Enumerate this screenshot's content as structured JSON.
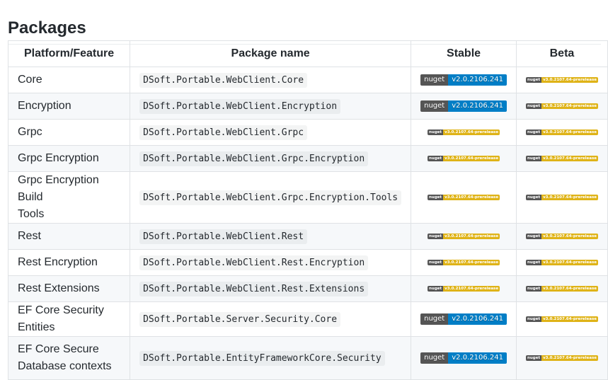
{
  "heading": "Packages",
  "columns": [
    "Platform/Feature",
    "Package name",
    "Stable",
    "Beta"
  ],
  "colors": {
    "badge_label": "#555555",
    "stable_release": "#007ec6",
    "prerelease": "#dfb317"
  },
  "rows": [
    {
      "feature": "Core",
      "package": "DSoft.Portable.WebClient.Core",
      "stable": {
        "label": "nuget",
        "version": "v2.0.2106.241",
        "kind": "release"
      },
      "beta": {
        "label": "nuget",
        "version": "v3.0.2107.64-prerelease",
        "kind": "prerelease"
      }
    },
    {
      "feature": "Encryption",
      "package": "DSoft.Portable.WebClient.Encryption",
      "stable": {
        "label": "nuget",
        "version": "v2.0.2106.241",
        "kind": "release"
      },
      "beta": {
        "label": "nuget",
        "version": "v3.0.2107.64-prerelease",
        "kind": "prerelease"
      }
    },
    {
      "feature": "Grpc",
      "package": "DSoft.Portable.WebClient.Grpc",
      "stable": {
        "label": "nuget",
        "version": "v3.0.2107.64-prerelease",
        "kind": "prerelease"
      },
      "beta": {
        "label": "nuget",
        "version": "v3.0.2107.64-prerelease",
        "kind": "prerelease"
      }
    },
    {
      "feature": "Grpc Encryption",
      "package": "DSoft.Portable.WebClient.Grpc.Encryption",
      "stable": {
        "label": "nuget",
        "version": "v3.0.2107.64-prerelease",
        "kind": "prerelease"
      },
      "beta": {
        "label": "nuget",
        "version": "v3.0.2107.64-prerelease",
        "kind": "prerelease"
      }
    },
    {
      "feature_line1": "Grpc Encryption Build",
      "feature_line2": "Tools",
      "package": "DSoft.Portable.WebClient.Grpc.Encryption.Tools",
      "stable": {
        "label": "nuget",
        "version": "v3.0.2107.64-prerelease",
        "kind": "prerelease"
      },
      "beta": {
        "label": "nuget",
        "version": "v3.0.2107.64-prerelease",
        "kind": "prerelease"
      }
    },
    {
      "feature": "Rest",
      "package": "DSoft.Portable.WebClient.Rest",
      "stable": {
        "label": "nuget",
        "version": "v3.0.2107.64-prerelease",
        "kind": "prerelease"
      },
      "beta": {
        "label": "nuget",
        "version": "v3.0.2107.64-prerelease",
        "kind": "prerelease"
      }
    },
    {
      "feature": "Rest Encryption",
      "package": "DSoft.Portable.WebClient.Rest.Encryption",
      "stable": {
        "label": "nuget",
        "version": "v3.0.2107.64-prerelease",
        "kind": "prerelease"
      },
      "beta": {
        "label": "nuget",
        "version": "v3.0.2107.64-prerelease",
        "kind": "prerelease"
      }
    },
    {
      "feature": "Rest Extensions",
      "package": "DSoft.Portable.WebClient.Rest.Extensions",
      "stable": {
        "label": "nuget",
        "version": "v3.0.2107.64-prerelease",
        "kind": "prerelease"
      },
      "beta": {
        "label": "nuget",
        "version": "v3.0.2107.64-prerelease",
        "kind": "prerelease"
      }
    },
    {
      "feature": "EF Core Security Entities",
      "package": "DSoft.Portable.Server.Security.Core",
      "stable": {
        "label": "nuget",
        "version": "v2.0.2106.241",
        "kind": "release"
      },
      "beta": {
        "label": "nuget",
        "version": "v3.0.2107.64-prerelease",
        "kind": "prerelease"
      }
    },
    {
      "feature_line1": "EF Core Secure",
      "feature_line2": "Database contexts",
      "package": "DSoft.Portable.EntityFrameworkCore.Security",
      "stable": {
        "label": "nuget",
        "version": "v2.0.2106.241",
        "kind": "release"
      },
      "beta": {
        "label": "nuget",
        "version": "v3.0.2107.64-prerelease",
        "kind": "prerelease"
      }
    }
  ]
}
